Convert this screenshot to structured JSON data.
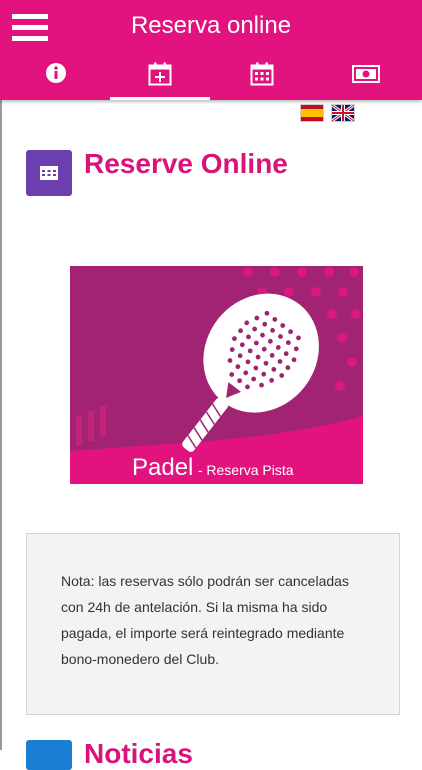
{
  "app": {
    "title": "Reserva online"
  },
  "tabs": [
    {
      "icon": "info-icon",
      "active": false
    },
    {
      "icon": "calendar-add-icon",
      "active": true
    },
    {
      "icon": "calendar-icon",
      "active": false
    },
    {
      "icon": "money-icon",
      "active": false
    }
  ],
  "languages": [
    {
      "code": "es",
      "icon": "spain-flag-icon"
    },
    {
      "code": "en",
      "icon": "uk-flag-icon"
    }
  ],
  "section": {
    "title": "Reserve Online",
    "icon": "calendar-icon"
  },
  "banner": {
    "title": "Padel",
    "subtitle": "- Reserva Pista",
    "icon": "padel-racket-icon"
  },
  "note": {
    "text": "Nota: las reservas sólo podrán ser canceladas con 24h de antelación. Si la misma ha sido pagada, el importe será reintegrado mediante bono-monedero del Club."
  },
  "next_section": {
    "title": "Noticias"
  },
  "colors": {
    "primary": "#e2137f",
    "accent_purple": "#6c3fb1",
    "heading": "#d8137a",
    "banner_bg": "#e2137f",
    "banner_shape": "#9b2570"
  }
}
